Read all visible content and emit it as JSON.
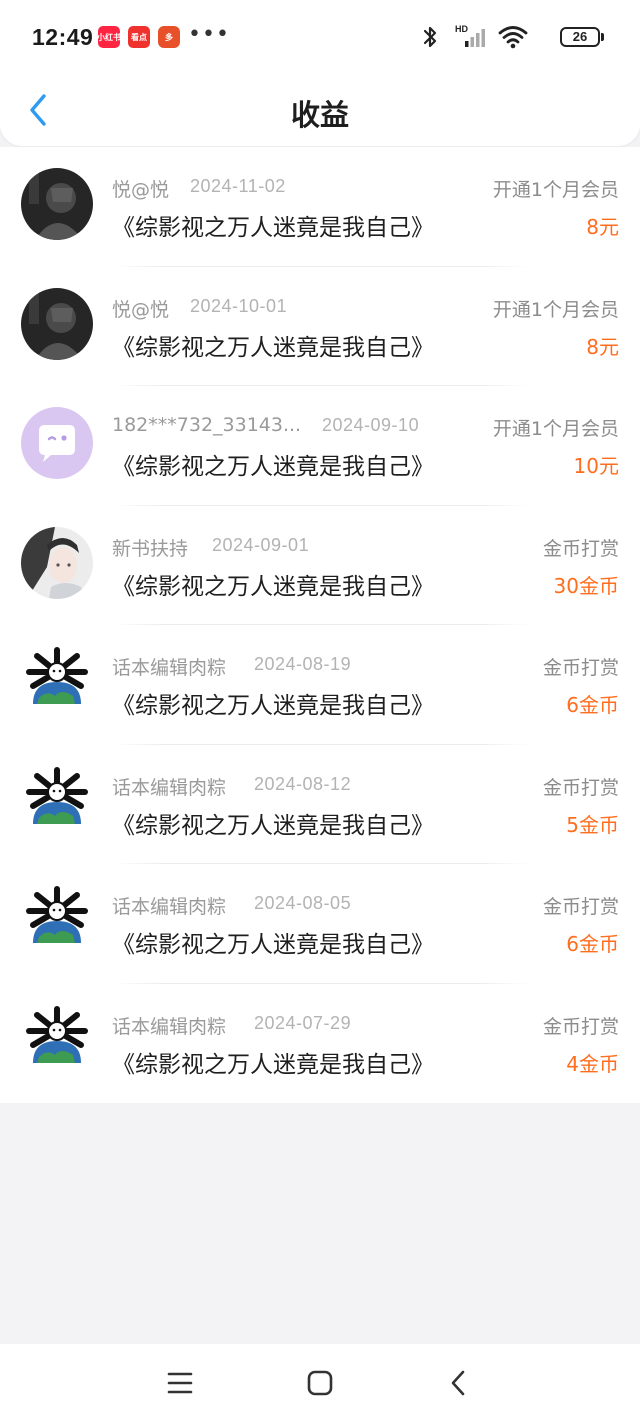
{
  "status_bar": {
    "time": "12:49",
    "app_badges": [
      "小红书",
      "看点",
      "多"
    ],
    "more": "•••",
    "battery": "26",
    "network": "HD"
  },
  "header": {
    "title": "收益"
  },
  "colors": {
    "amount": "#ff6d1f",
    "back_arrow": "#2e9bf0"
  },
  "earnings": [
    {
      "user": "悦@悦",
      "date": "2024-11-02",
      "type": "开通1个月会员",
      "book": "《综影视之万人迷竟是我自己》",
      "amount": "8元",
      "avatar": "dark-photo-avatar"
    },
    {
      "user": "悦@悦",
      "date": "2024-10-01",
      "type": "开通1个月会员",
      "book": "《综影视之万人迷竟是我自己》",
      "amount": "8元",
      "avatar": "dark-photo-avatar"
    },
    {
      "user": "182***732_33143...",
      "date": "2024-09-10",
      "type": "开通1个月会员",
      "book": "《综影视之万人迷竟是我自己》",
      "amount": "10元",
      "avatar": "default-chat-avatar"
    },
    {
      "user": "新书扶持",
      "date": "2024-09-01",
      "type": "金币打赏",
      "book": "《综影视之万人迷竟是我自己》",
      "amount": "30金币",
      "avatar": "anime-character-avatar"
    },
    {
      "user": "话本编辑肉粽",
      "date": "2024-08-19",
      "type": "金币打赏",
      "book": "《综影视之万人迷竟是我自己》",
      "amount": "6金币",
      "avatar": "cartoon-earth-avatar"
    },
    {
      "user": "话本编辑肉粽",
      "date": "2024-08-12",
      "type": "金币打赏",
      "book": "《综影视之万人迷竟是我自己》",
      "amount": "5金币",
      "avatar": "cartoon-earth-avatar"
    },
    {
      "user": "话本编辑肉粽",
      "date": "2024-08-05",
      "type": "金币打赏",
      "book": "《综影视之万人迷竟是我自己》",
      "amount": "6金币",
      "avatar": "cartoon-earth-avatar"
    },
    {
      "user": "话本编辑肉粽",
      "date": "2024-07-29",
      "type": "金币打赏",
      "book": "《综影视之万人迷竟是我自己》",
      "amount": "4金币",
      "avatar": "cartoon-earth-avatar"
    }
  ],
  "nav": {
    "icons": [
      "menu-icon",
      "home-square-icon",
      "back-triangle-icon"
    ]
  }
}
